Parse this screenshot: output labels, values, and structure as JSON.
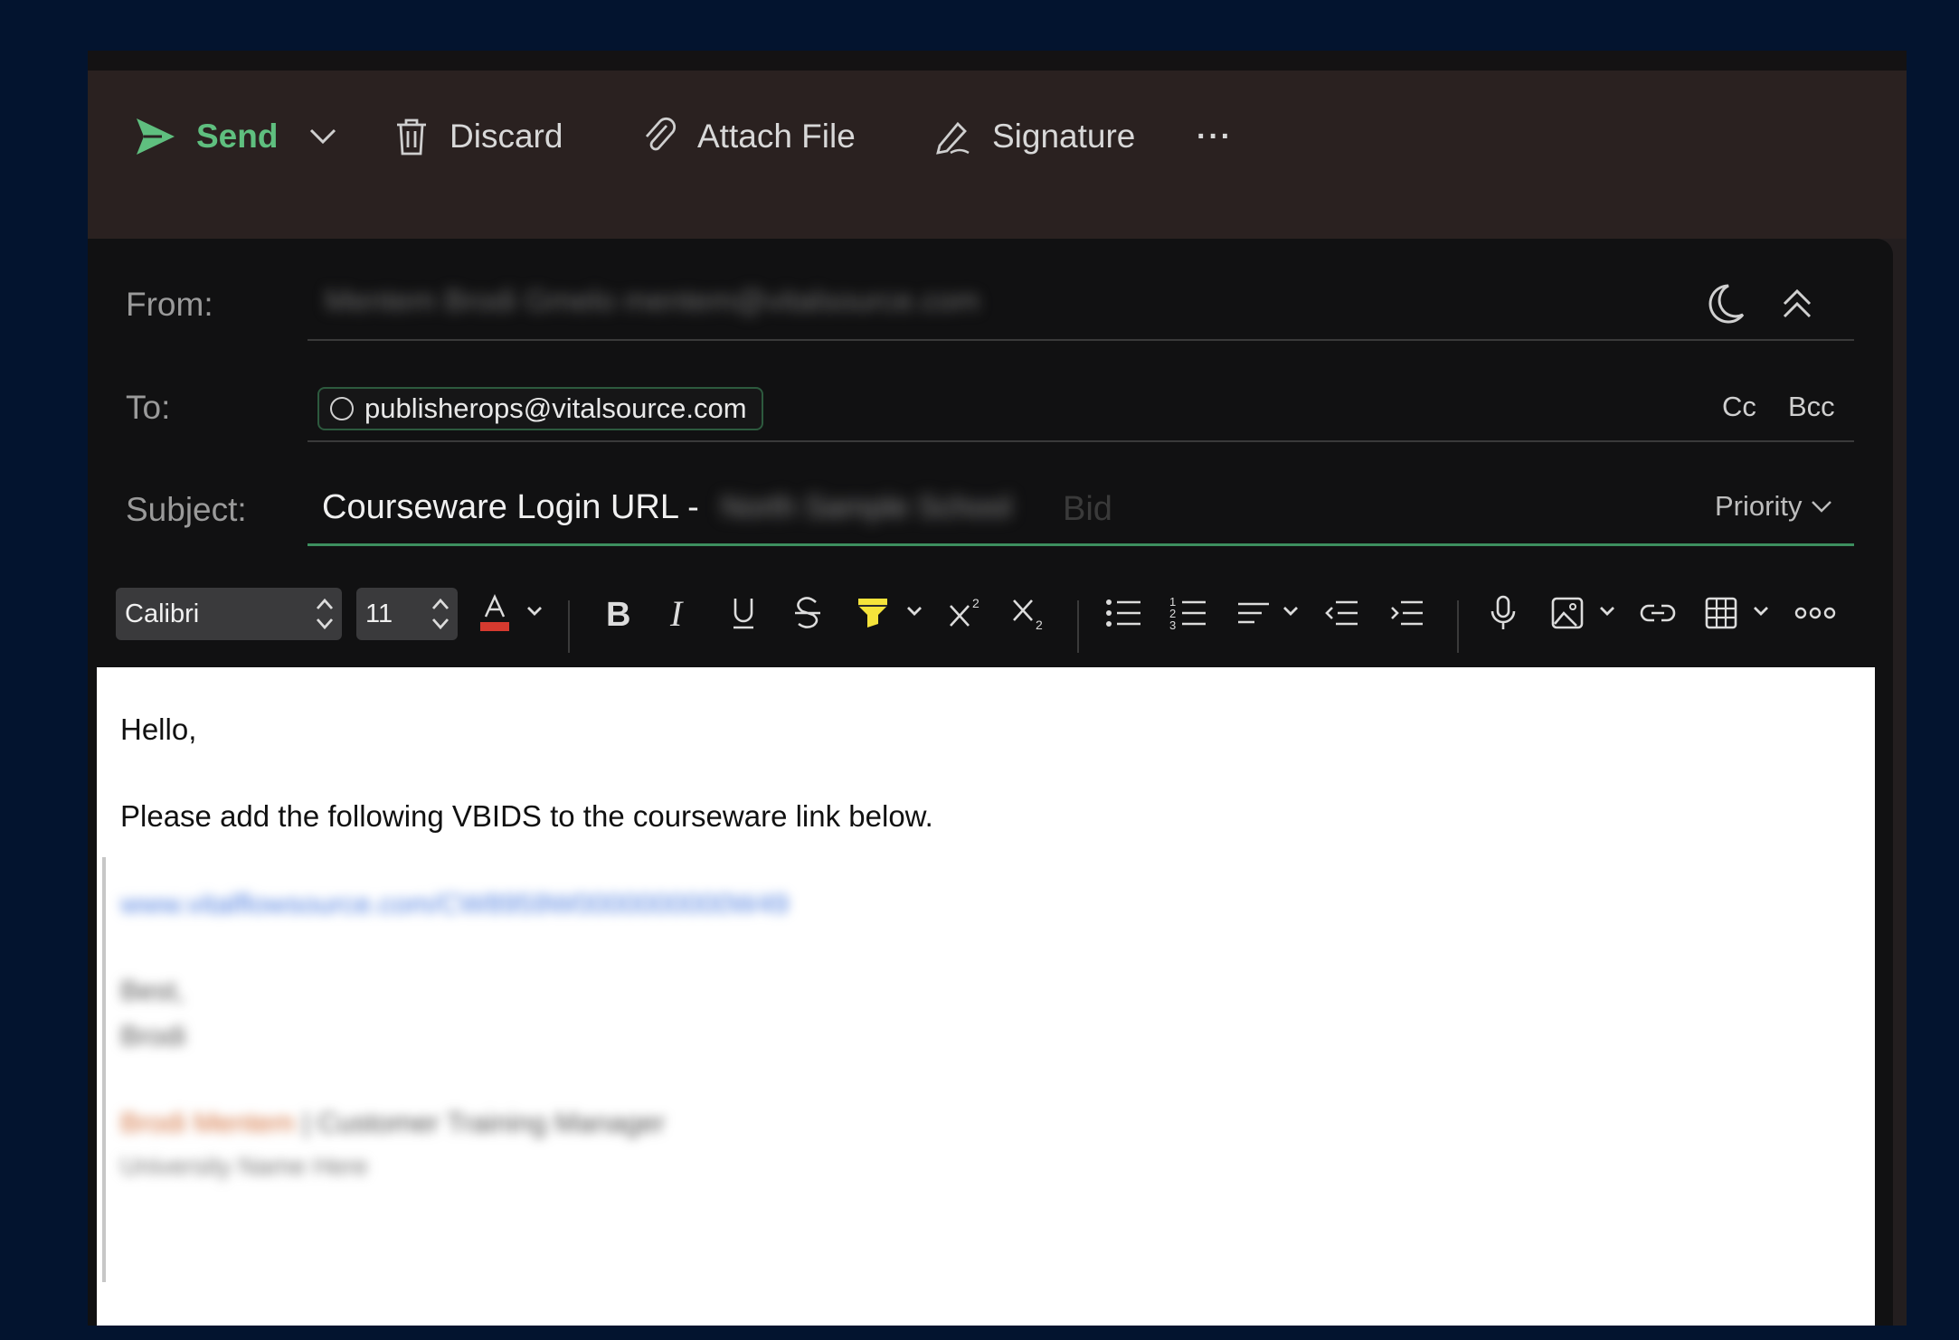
{
  "toolbar": {
    "send": "Send",
    "discard": "Discard",
    "attach": "Attach File",
    "signature": "Signature",
    "more": "···"
  },
  "header": {
    "from_label": "From:",
    "from_value": "Mentem Brodi Gmelo mentem@vitalsource.com",
    "to_label": "To:",
    "recipient": "publisherops@vitalsource.com",
    "cc": "Cc",
    "bcc": "Bcc",
    "subject_label": "Subject:",
    "subject_value": "Courseware Login URL -",
    "subject_redacted": "North Sample School",
    "subject_tail": "Bid",
    "priority": "Priority"
  },
  "format": {
    "font": "Calibri",
    "size": "11"
  },
  "body": {
    "greeting": "Hello,",
    "paragraph": "Please add the following VBIDS to the courseware link below.",
    "link": "www.vitalflowsource.com/CW8959W0000000000W49",
    "sig_line1": "Best,",
    "sig_line2": "Brodi",
    "sig_name": "Brodi Mentem",
    "sig_title": "| Customer Training Manager",
    "sig_org": "University Name Here"
  },
  "colors": {
    "accent": "#5fbf7f",
    "background": "#03142f",
    "highlight": "#f5e33b",
    "font_color_bar": "#d63a2f"
  }
}
